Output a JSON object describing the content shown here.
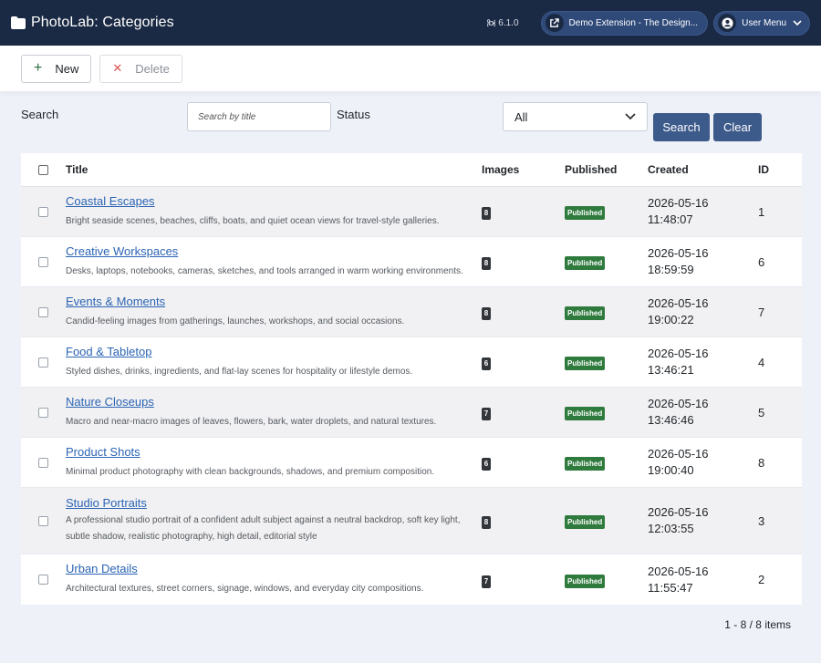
{
  "header": {
    "title": "PhotoLab: Categories",
    "version": "6.1.0",
    "site_link": "Demo Extension - The Design...",
    "user_menu": "User Menu"
  },
  "toolbar": {
    "new_label": "New",
    "delete_label": "Delete"
  },
  "filters": {
    "search_label": "Search",
    "search_placeholder": "Search by title",
    "search_value": "",
    "status_label": "Status",
    "status_value": "All",
    "search_button": "Search",
    "clear_button": "Clear"
  },
  "table": {
    "columns": {
      "title": "Title",
      "images": "Images",
      "published": "Published",
      "created": "Created",
      "id": "ID"
    },
    "rows": [
      {
        "title": "Coastal Escapes",
        "description": "Bright seaside scenes, beaches, cliffs, boats, and quiet ocean views for travel-style galleries.",
        "images": "8",
        "status": "Published",
        "date": "2026-05-16",
        "time": "11:48:07",
        "id": "1"
      },
      {
        "title": "Creative Workspaces",
        "description": "Desks, laptops, notebooks, cameras, sketches, and tools arranged in warm working environments.",
        "images": "8",
        "status": "Published",
        "date": "2026-05-16",
        "time": "18:59:59",
        "id": "6"
      },
      {
        "title": "Events & Moments",
        "description": "Candid-feeling images from gatherings, launches, workshops, and social occasions.",
        "images": "8",
        "status": "Published",
        "date": "2026-05-16",
        "time": "19:00:22",
        "id": "7"
      },
      {
        "title": "Food & Tabletop",
        "description": "Styled dishes, drinks, ingredients, and flat-lay scenes for hospitality or lifestyle demos.",
        "images": "6",
        "status": "Published",
        "date": "2026-05-16",
        "time": "13:46:21",
        "id": "4"
      },
      {
        "title": "Nature Closeups",
        "description": "Macro and near-macro images of leaves, flowers, bark, water droplets, and natural textures.",
        "images": "7",
        "status": "Published",
        "date": "2026-05-16",
        "time": "13:46:46",
        "id": "5"
      },
      {
        "title": "Product Shots",
        "description": "Minimal product photography with clean backgrounds, shadows, and premium composition.",
        "images": "6",
        "status": "Published",
        "date": "2026-05-16",
        "time": "19:00:40",
        "id": "8"
      },
      {
        "title": "Studio Portraits",
        "description": "A professional studio portrait of a confident adult subject against a neutral backdrop, soft key light, subtle shadow, realistic photography, high detail, editorial style",
        "images": "8",
        "status": "Published",
        "date": "2026-05-16",
        "time": "12:03:55",
        "id": "3"
      },
      {
        "title": "Urban Details",
        "description": "Architectural textures, street corners, signage, windows, and everyday city compositions.",
        "images": "7",
        "status": "Published",
        "date": "2026-05-16",
        "time": "11:55:47",
        "id": "2"
      }
    ]
  },
  "pagination": {
    "summary": "1 - 8 / 8 items"
  },
  "colors": {
    "header_bg": "#1b2a44",
    "accent": "#3c5a8a",
    "published": "#2f7a3d",
    "link": "#2b64b3"
  }
}
